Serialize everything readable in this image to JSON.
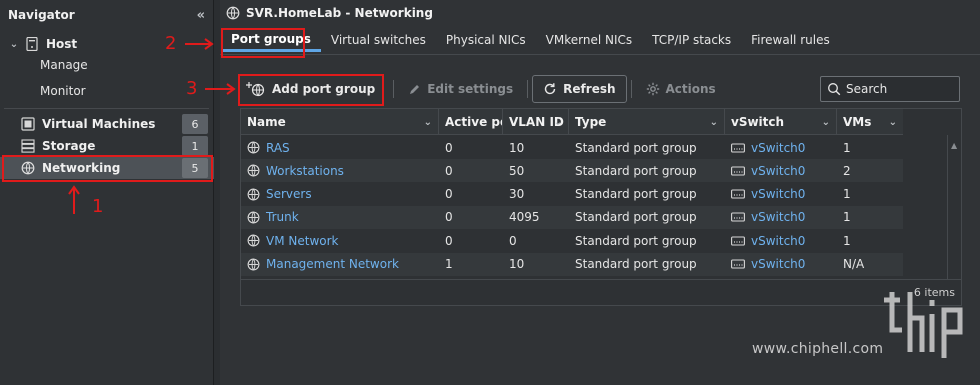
{
  "navigator": {
    "title": "Navigator",
    "host": {
      "label": "Host",
      "children": [
        "Manage",
        "Monitor"
      ]
    },
    "items": [
      {
        "label": "Virtual Machines",
        "count": "6"
      },
      {
        "label": "Storage",
        "count": "1"
      },
      {
        "label": "Networking",
        "count": "5"
      }
    ]
  },
  "window_title": "SVR.HomeLab - Networking",
  "tabs": [
    "Port groups",
    "Virtual switches",
    "Physical NICs",
    "VMkernel NICs",
    "TCP/IP stacks",
    "Firewall rules"
  ],
  "active_tab": "Port groups",
  "toolbar": {
    "add": "Add port group",
    "edit": "Edit settings",
    "refresh": "Refresh",
    "actions": "Actions",
    "search_placeholder": "Search"
  },
  "grid": {
    "columns": [
      "Name",
      "Active por",
      "VLAN ID",
      "Type",
      "vSwitch",
      "VMs"
    ],
    "rows": [
      {
        "name": "RAS",
        "active": "0",
        "vlan": "10",
        "type": "Standard port group",
        "vswitch": "vSwitch0",
        "vms": "1"
      },
      {
        "name": "Workstations",
        "active": "0",
        "vlan": "50",
        "type": "Standard port group",
        "vswitch": "vSwitch0",
        "vms": "2"
      },
      {
        "name": "Servers",
        "active": "0",
        "vlan": "30",
        "type": "Standard port group",
        "vswitch": "vSwitch0",
        "vms": "1"
      },
      {
        "name": "Trunk",
        "active": "0",
        "vlan": "4095",
        "type": "Standard port group",
        "vswitch": "vSwitch0",
        "vms": "1"
      },
      {
        "name": "VM Network",
        "active": "0",
        "vlan": "0",
        "type": "Standard port group",
        "vswitch": "vSwitch0",
        "vms": "1"
      },
      {
        "name": "Management Network",
        "active": "1",
        "vlan": "10",
        "type": "Standard port group",
        "vswitch": "vSwitch0",
        "vms": "N/A"
      }
    ],
    "items_count": "6 items"
  },
  "annotations": [
    "1",
    "2",
    "3"
  ],
  "watermark": "www.chiphell.com",
  "colors": {
    "accent": "#5fa6e6",
    "link": "#6fb2ee",
    "highlight": "#e01b1b"
  }
}
